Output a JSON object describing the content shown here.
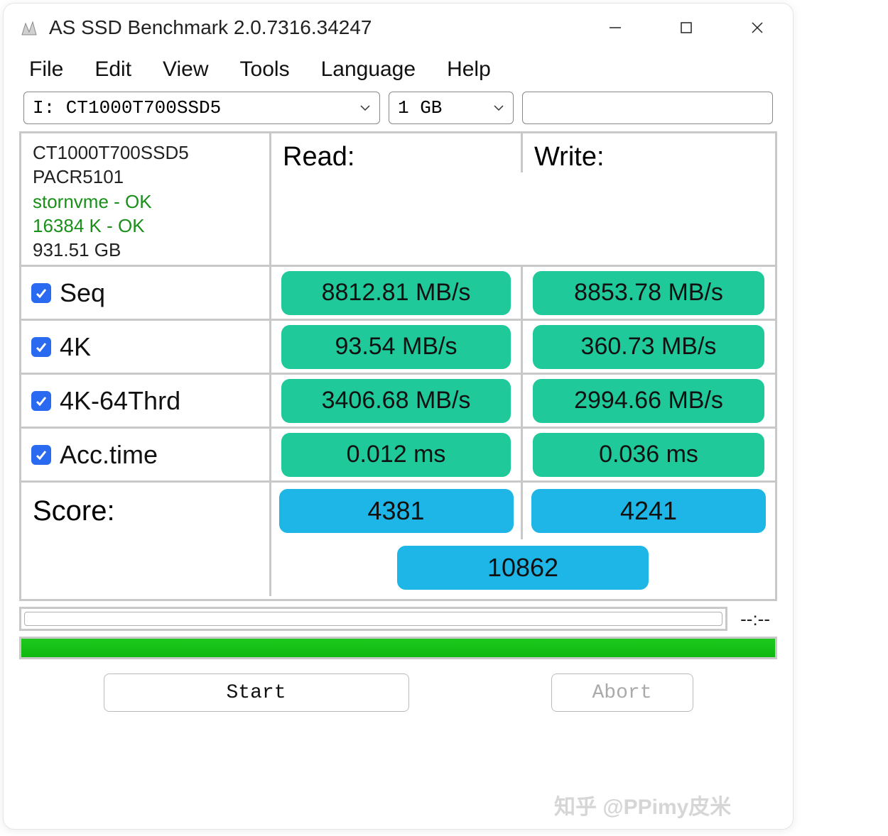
{
  "titlebar": {
    "title": "AS SSD Benchmark 2.0.7316.34247"
  },
  "menubar": [
    "File",
    "Edit",
    "View",
    "Tools",
    "Language",
    "Help"
  ],
  "drive_select": {
    "value": "I: CT1000T700SSD5"
  },
  "size_select": {
    "value": "1 GB"
  },
  "device_info": {
    "model": "CT1000T700SSD5",
    "firmware": "PACR5101",
    "driver_status": "stornvme - OK",
    "align_status": "16384 K - OK",
    "capacity": "931.51 GB"
  },
  "headers": {
    "read": "Read:",
    "write": "Write:"
  },
  "tests": [
    {
      "key": "seq",
      "label": "Seq",
      "read": "8812.81 MB/s",
      "write": "8853.78 MB/s",
      "checked": true
    },
    {
      "key": "4k",
      "label": "4K",
      "read": "93.54 MB/s",
      "write": "360.73 MB/s",
      "checked": true
    },
    {
      "key": "4k64",
      "label": "4K-64Thrd",
      "read": "3406.68 MB/s",
      "write": "2994.66 MB/s",
      "checked": true
    },
    {
      "key": "acc",
      "label": "Acc.time",
      "read": "0.012 ms",
      "write": "0.036 ms",
      "checked": true
    }
  ],
  "score": {
    "label": "Score:",
    "read": "4381",
    "write": "4241",
    "total": "10862"
  },
  "status_text": "--:--",
  "buttons": {
    "start": "Start",
    "abort": "Abort"
  },
  "watermark": "知乎 @PPimy皮米"
}
